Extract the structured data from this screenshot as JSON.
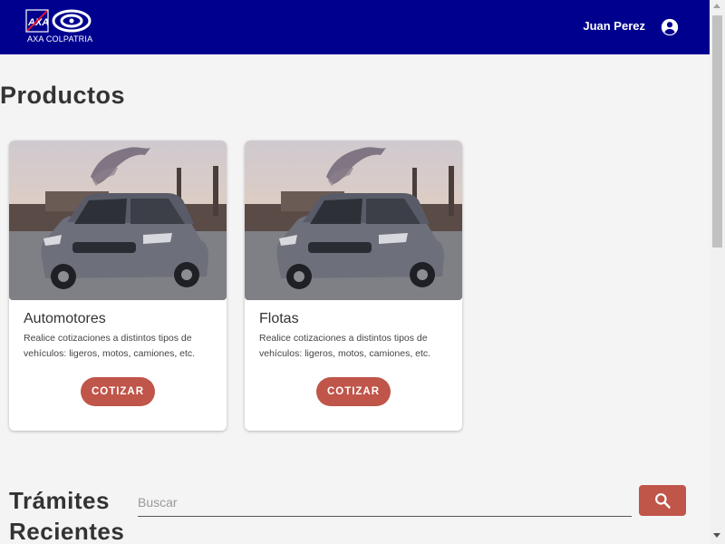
{
  "header": {
    "brand": "AXA COLPATRIA",
    "user_name": "Juan Perez",
    "account_icon": "account-circle-icon",
    "bg_color": "#00008f"
  },
  "products": {
    "title": "Productos",
    "cards": [
      {
        "title": "Automotores",
        "description": "Realice cotizaciones a distintos tipos de vehículos: ligeros, motos, camiones, etc.",
        "button": "COTIZAR",
        "image": "car-photo"
      },
      {
        "title": "Flotas",
        "description": "Realice cotizaciones a distintos tipos de vehículos: ligeros, motos, camiones, etc.",
        "button": "COTIZAR",
        "image": "car-photo"
      }
    ]
  },
  "tramites": {
    "title_line1": "Trámites",
    "title_line2": "Recientes",
    "search_placeholder": "Buscar",
    "search_icon": "search-icon",
    "accent_color": "#c0554a"
  }
}
